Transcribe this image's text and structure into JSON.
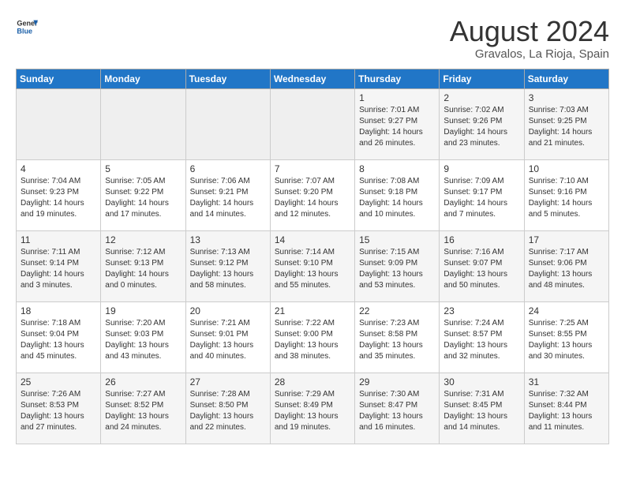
{
  "header": {
    "logo_line1": "General",
    "logo_line2": "Blue",
    "month_year": "August 2024",
    "location": "Gravalos, La Rioja, Spain"
  },
  "weekdays": [
    "Sunday",
    "Monday",
    "Tuesday",
    "Wednesday",
    "Thursday",
    "Friday",
    "Saturday"
  ],
  "weeks": [
    [
      {
        "day": "",
        "info": ""
      },
      {
        "day": "",
        "info": ""
      },
      {
        "day": "",
        "info": ""
      },
      {
        "day": "",
        "info": ""
      },
      {
        "day": "1",
        "info": "Sunrise: 7:01 AM\nSunset: 9:27 PM\nDaylight: 14 hours\nand 26 minutes."
      },
      {
        "day": "2",
        "info": "Sunrise: 7:02 AM\nSunset: 9:26 PM\nDaylight: 14 hours\nand 23 minutes."
      },
      {
        "day": "3",
        "info": "Sunrise: 7:03 AM\nSunset: 9:25 PM\nDaylight: 14 hours\nand 21 minutes."
      }
    ],
    [
      {
        "day": "4",
        "info": "Sunrise: 7:04 AM\nSunset: 9:23 PM\nDaylight: 14 hours\nand 19 minutes."
      },
      {
        "day": "5",
        "info": "Sunrise: 7:05 AM\nSunset: 9:22 PM\nDaylight: 14 hours\nand 17 minutes."
      },
      {
        "day": "6",
        "info": "Sunrise: 7:06 AM\nSunset: 9:21 PM\nDaylight: 14 hours\nand 14 minutes."
      },
      {
        "day": "7",
        "info": "Sunrise: 7:07 AM\nSunset: 9:20 PM\nDaylight: 14 hours\nand 12 minutes."
      },
      {
        "day": "8",
        "info": "Sunrise: 7:08 AM\nSunset: 9:18 PM\nDaylight: 14 hours\nand 10 minutes."
      },
      {
        "day": "9",
        "info": "Sunrise: 7:09 AM\nSunset: 9:17 PM\nDaylight: 14 hours\nand 7 minutes."
      },
      {
        "day": "10",
        "info": "Sunrise: 7:10 AM\nSunset: 9:16 PM\nDaylight: 14 hours\nand 5 minutes."
      }
    ],
    [
      {
        "day": "11",
        "info": "Sunrise: 7:11 AM\nSunset: 9:14 PM\nDaylight: 14 hours\nand 3 minutes."
      },
      {
        "day": "12",
        "info": "Sunrise: 7:12 AM\nSunset: 9:13 PM\nDaylight: 14 hours\nand 0 minutes."
      },
      {
        "day": "13",
        "info": "Sunrise: 7:13 AM\nSunset: 9:12 PM\nDaylight: 13 hours\nand 58 minutes."
      },
      {
        "day": "14",
        "info": "Sunrise: 7:14 AM\nSunset: 9:10 PM\nDaylight: 13 hours\nand 55 minutes."
      },
      {
        "day": "15",
        "info": "Sunrise: 7:15 AM\nSunset: 9:09 PM\nDaylight: 13 hours\nand 53 minutes."
      },
      {
        "day": "16",
        "info": "Sunrise: 7:16 AM\nSunset: 9:07 PM\nDaylight: 13 hours\nand 50 minutes."
      },
      {
        "day": "17",
        "info": "Sunrise: 7:17 AM\nSunset: 9:06 PM\nDaylight: 13 hours\nand 48 minutes."
      }
    ],
    [
      {
        "day": "18",
        "info": "Sunrise: 7:18 AM\nSunset: 9:04 PM\nDaylight: 13 hours\nand 45 minutes."
      },
      {
        "day": "19",
        "info": "Sunrise: 7:20 AM\nSunset: 9:03 PM\nDaylight: 13 hours\nand 43 minutes."
      },
      {
        "day": "20",
        "info": "Sunrise: 7:21 AM\nSunset: 9:01 PM\nDaylight: 13 hours\nand 40 minutes."
      },
      {
        "day": "21",
        "info": "Sunrise: 7:22 AM\nSunset: 9:00 PM\nDaylight: 13 hours\nand 38 minutes."
      },
      {
        "day": "22",
        "info": "Sunrise: 7:23 AM\nSunset: 8:58 PM\nDaylight: 13 hours\nand 35 minutes."
      },
      {
        "day": "23",
        "info": "Sunrise: 7:24 AM\nSunset: 8:57 PM\nDaylight: 13 hours\nand 32 minutes."
      },
      {
        "day": "24",
        "info": "Sunrise: 7:25 AM\nSunset: 8:55 PM\nDaylight: 13 hours\nand 30 minutes."
      }
    ],
    [
      {
        "day": "25",
        "info": "Sunrise: 7:26 AM\nSunset: 8:53 PM\nDaylight: 13 hours\nand 27 minutes."
      },
      {
        "day": "26",
        "info": "Sunrise: 7:27 AM\nSunset: 8:52 PM\nDaylight: 13 hours\nand 24 minutes."
      },
      {
        "day": "27",
        "info": "Sunrise: 7:28 AM\nSunset: 8:50 PM\nDaylight: 13 hours\nand 22 minutes."
      },
      {
        "day": "28",
        "info": "Sunrise: 7:29 AM\nSunset: 8:49 PM\nDaylight: 13 hours\nand 19 minutes."
      },
      {
        "day": "29",
        "info": "Sunrise: 7:30 AM\nSunset: 8:47 PM\nDaylight: 13 hours\nand 16 minutes."
      },
      {
        "day": "30",
        "info": "Sunrise: 7:31 AM\nSunset: 8:45 PM\nDaylight: 13 hours\nand 14 minutes."
      },
      {
        "day": "31",
        "info": "Sunrise: 7:32 AM\nSunset: 8:44 PM\nDaylight: 13 hours\nand 11 minutes."
      }
    ]
  ]
}
